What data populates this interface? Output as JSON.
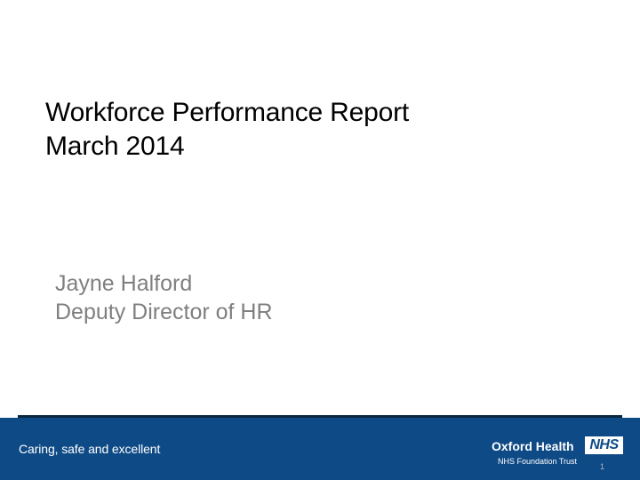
{
  "slide": {
    "title_line1": "Workforce Performance Report",
    "title_line2": "March 2014",
    "subtitle_line1": "Jayne Halford",
    "subtitle_line2": "Deputy Director of HR"
  },
  "footer": {
    "tagline": "Caring, safe and excellent",
    "org_name": "Oxford Health",
    "org_subtitle": "NHS Foundation Trust",
    "logo_text": "NHS",
    "slide_number": "1"
  },
  "colors": {
    "footer_background": "#0e4a86",
    "footer_shadow": "#0c2740",
    "subtitle_text": "#7f7f7f"
  }
}
